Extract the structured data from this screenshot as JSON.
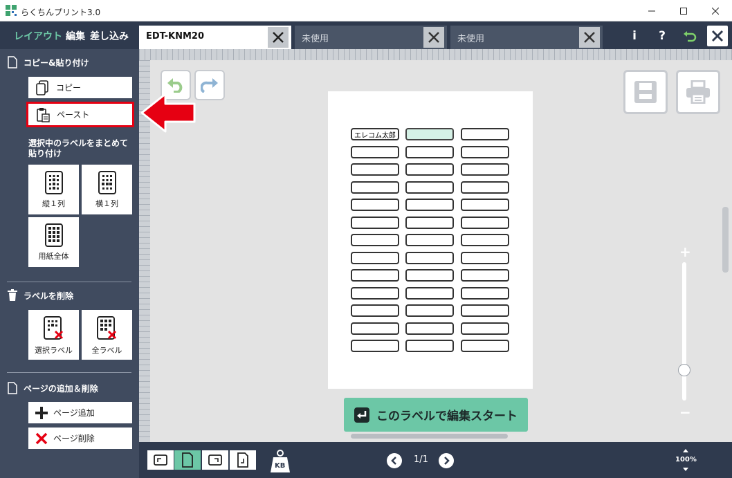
{
  "window": {
    "title": "らくちんプリント3.0"
  },
  "modes": {
    "layout": "レイアウト",
    "edit": "編集",
    "merge": "差し込み"
  },
  "tabs": [
    {
      "label": "EDT-KNM20"
    },
    {
      "label": "未使用"
    },
    {
      "label": "未使用"
    }
  ],
  "top_icons": {
    "info": "i",
    "help": "?"
  },
  "sidebar": {
    "copy_paste": {
      "header": "コピー&貼り付け",
      "copy": "コピー",
      "paste": "ペースト"
    },
    "bulk_paste": {
      "header": "選択中のラベルをまとめて貼り付け",
      "vertical": "縦１列",
      "horizontal": "横１列",
      "whole": "用紙全体"
    },
    "delete": {
      "header": "ラベルを削除",
      "selected": "選択ラベル",
      "all": "全ラベル"
    },
    "pages": {
      "header": "ページの追加＆削除",
      "add": "ページ追加",
      "remove": "ページ削除"
    }
  },
  "labels": {
    "rows": 13,
    "cols": 3,
    "first_text": "エレコム太郎"
  },
  "start_button": "このラベルで編集スタート",
  "zoom": {
    "plus": "+",
    "minus": "−",
    "level": "100%"
  },
  "pager": {
    "text": "1/1"
  },
  "kb_badge": "KB",
  "colors": {
    "dark": "#2f3a4e",
    "sidebar": "#404b5f",
    "accent": "#6cc7a6",
    "selected_label": "#d5f1e6",
    "highlight": "#e60012"
  }
}
